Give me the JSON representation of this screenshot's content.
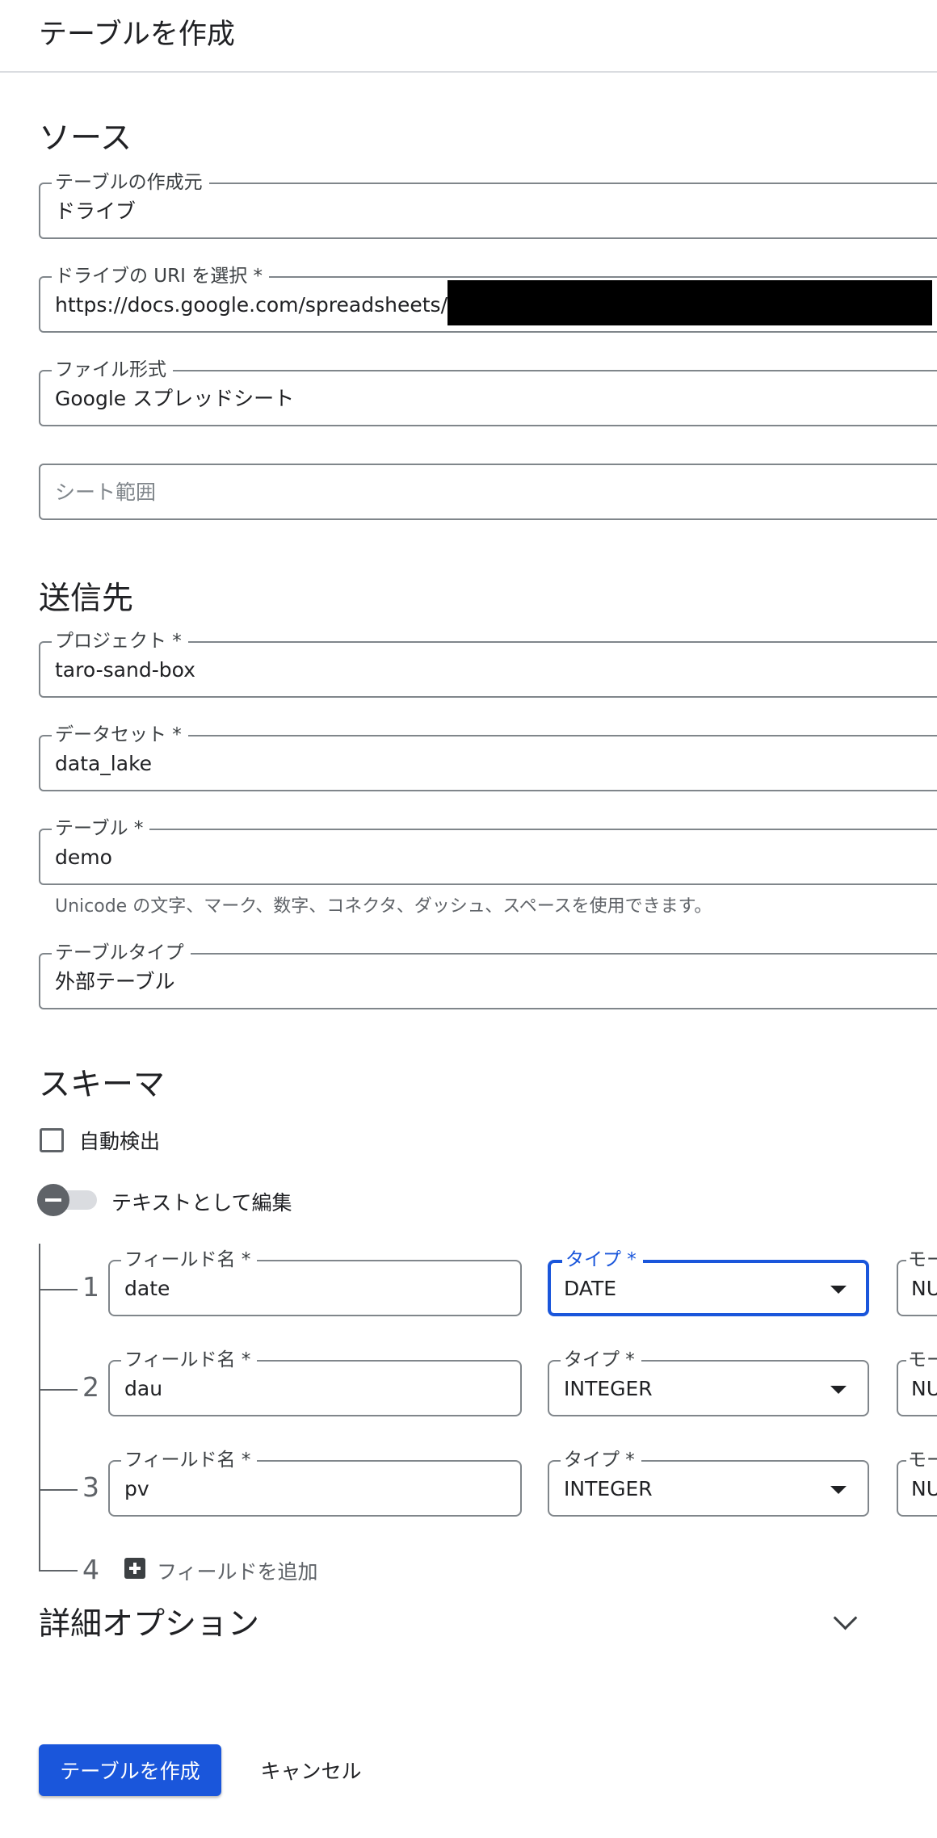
{
  "header": {
    "title": "テーブルを作成"
  },
  "source": {
    "title": "ソース",
    "create_from": {
      "label": "テーブルの作成元",
      "value": "ドライブ"
    },
    "drive_uri": {
      "label": "ドライブの URI を選択 *",
      "value": "https://docs.google.com/spreadsheets/d/"
    },
    "file_format": {
      "label": "ファイル形式",
      "value": "Google スプレッドシート"
    },
    "sheet_range": {
      "placeholder": "シート範囲"
    }
  },
  "destination": {
    "title": "送信先",
    "project": {
      "label": "プロジェクト *",
      "value": "taro-sand-box"
    },
    "dataset": {
      "label": "データセット *",
      "value": "data_lake"
    },
    "table": {
      "label": "テーブル *",
      "value": "demo"
    },
    "table_hint": "Unicode の文字、マーク、数字、コネクタ、ダッシュ、スペースを使用できます。",
    "table_type": {
      "label": "テーブルタイプ",
      "value": "外部テーブル"
    }
  },
  "schema": {
    "title": "スキーマ",
    "auto_detect_label": "自動検出",
    "auto_detect_checked": false,
    "edit_as_text_label": "テキストとして編集",
    "edit_as_text_on": false,
    "field_name_label": "フィールド名 *",
    "type_label": "タイプ *",
    "mode_label_partial": "モー",
    "rows": [
      {
        "num": "1",
        "name": "date",
        "type": "DATE",
        "mode_partial": "NU"
      },
      {
        "num": "2",
        "name": "dau",
        "type": "INTEGER",
        "mode_partial": "NU"
      },
      {
        "num": "3",
        "name": "pv",
        "type": "INTEGER",
        "mode_partial": "NU"
      }
    ],
    "add_row_num": "4",
    "add_field_label": "フィールドを追加"
  },
  "advanced": {
    "title": "詳細オプション"
  },
  "footer": {
    "create_label": "テーブルを作成",
    "cancel_label": "キャンセル"
  },
  "colors": {
    "primary": "#1a56db",
    "border": "#80868b",
    "text": "#202124",
    "secondary_text": "#5f6368"
  },
  "icons": {
    "checkbox": "checkbox-icon",
    "toggle": "toggle-icon",
    "dropdown": "dropdown-arrow-icon",
    "add": "add-box-icon",
    "expand": "chevron-down-icon"
  }
}
